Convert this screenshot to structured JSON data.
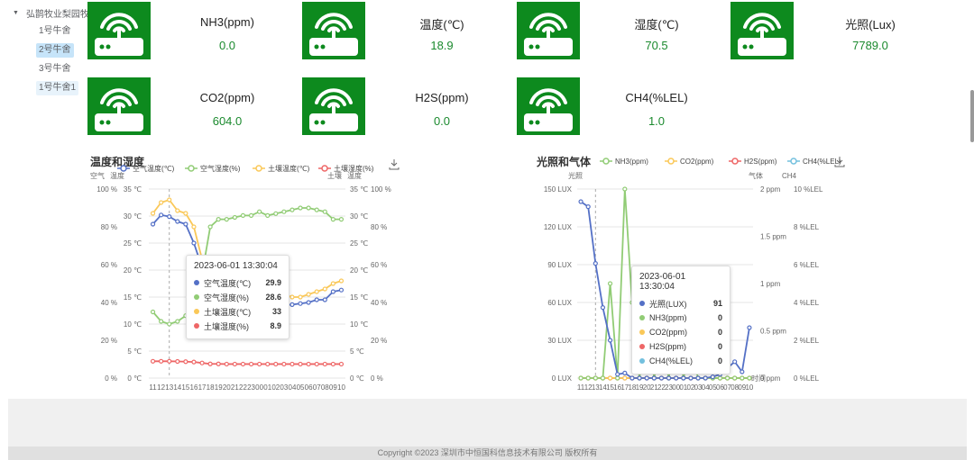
{
  "tree": {
    "root": "弘鹊牧业梨园牧场",
    "items": [
      {
        "label": "1号牛舍",
        "state": ""
      },
      {
        "label": "2号牛舍",
        "state": "active"
      },
      {
        "label": "3号牛舍",
        "state": ""
      },
      {
        "label": "1号牛舍1",
        "state": "current"
      }
    ]
  },
  "sensors": [
    {
      "name": "NH3(ppm)",
      "value": "0.0"
    },
    {
      "name": "温度(℃)",
      "value": "18.9"
    },
    {
      "name": "湿度(℃)",
      "value": "70.5"
    },
    {
      "name": "光照(Lux)",
      "value": "7789.0"
    },
    {
      "name": "CO2(ppm)",
      "value": "604.0"
    },
    {
      "name": "H2S(ppm)",
      "value": "0.0"
    },
    {
      "name": "CH4(%LEL)",
      "value": "1.0"
    }
  ],
  "colors": {
    "brand_green": "#0d8a1e",
    "value_green": "#1b8a2e",
    "blue": "#5470c6",
    "green": "#91cc75",
    "yellow": "#fac858",
    "red": "#ee6666",
    "cyan": "#73c0de"
  },
  "chart_data": [
    {
      "type": "line",
      "title": "温度和湿度",
      "legend": [
        "空气温度(℃)",
        "空气湿度(%)",
        "土壤温度(℃)",
        "土壤湿度(%)"
      ],
      "axis_names": [
        "空气",
        "温度",
        "土壤",
        "温度"
      ],
      "x": [
        "11",
        "12",
        "13",
        "14",
        "15",
        "16",
        "17",
        "18",
        "19",
        "20",
        "21",
        "22",
        "23",
        "00",
        "01",
        "02",
        "03",
        "04",
        "05",
        "06",
        "07",
        "08",
        "09",
        "10"
      ],
      "y_left_pct_ticks": [
        "0 %",
        "20 %",
        "40 %",
        "60 %",
        "80 %",
        "100 %"
      ],
      "y_left_c_ticks": [
        "0 ℃",
        "5 ℃",
        "10 ℃",
        "15 ℃",
        "20 ℃",
        "25 ℃",
        "30 ℃",
        "35 ℃"
      ],
      "y_right_c_ticks": [
        "0 ℃",
        "5 ℃",
        "10 ℃",
        "15 ℃",
        "20 ℃",
        "25 ℃",
        "30 ℃",
        "35 ℃"
      ],
      "y_right_pct_ticks": [
        "0 %",
        "20 %",
        "40 %",
        "60 %",
        "80 %",
        "100 %"
      ],
      "series": [
        {
          "name": "空气温度(℃)",
          "axis": "c",
          "color": "#5470c6",
          "values": [
            28.5,
            30.2,
            29.9,
            29.0,
            28.5,
            25.0,
            20.5,
            18.5,
            17.5,
            16.5,
            16.0,
            15.5,
            15.0,
            14.5,
            14.0,
            13.8,
            13.5,
            13.6,
            13.8,
            14.0,
            14.5,
            14.5,
            16.0,
            16.3
          ]
        },
        {
          "name": "空气湿度(%)",
          "axis": "p",
          "color": "#91cc75",
          "values": [
            35.0,
            30.0,
            28.6,
            30.0,
            33.0,
            40.0,
            55.0,
            80.0,
            84.0,
            84.0,
            85.0,
            86.0,
            86.0,
            88.0,
            86.0,
            87.0,
            88.0,
            89.0,
            90.0,
            90.0,
            89.0,
            88.0,
            84.0,
            84.0
          ]
        },
        {
          "name": "土壤温度(℃)",
          "axis": "c",
          "color": "#fac858",
          "values": [
            30.5,
            32.5,
            33.0,
            31.0,
            30.5,
            28.0,
            22.0,
            20.5,
            19.5,
            18.5,
            18.0,
            17.0,
            16.5,
            16.0,
            15.5,
            15.5,
            15.5,
            15.0,
            15.0,
            15.5,
            16.0,
            16.5,
            17.5,
            18.0
          ]
        },
        {
          "name": "土壤湿度(%)",
          "axis": "p",
          "color": "#ee6666",
          "values": [
            8.9,
            8.9,
            8.9,
            8.8,
            8.7,
            8.5,
            8.0,
            7.5,
            7.5,
            7.4,
            7.4,
            7.4,
            7.4,
            7.4,
            7.4,
            7.4,
            7.4,
            7.4,
            7.4,
            7.4,
            7.4,
            7.4,
            7.4,
            7.4
          ]
        }
      ],
      "tooltip": {
        "time": "2023-06-01 13:30:04",
        "rows": [
          {
            "name": "空气温度(℃)",
            "value": "29.9",
            "color": "#5470c6"
          },
          {
            "name": "空气湿度(%)",
            "value": "28.6",
            "color": "#91cc75"
          },
          {
            "name": "土壤温度(℃)",
            "value": "33",
            "color": "#fac858"
          },
          {
            "name": "土壤湿度(%)",
            "value": "8.9",
            "color": "#ee6666"
          }
        ]
      }
    },
    {
      "type": "line",
      "title": "光照和气体",
      "legend": [
        "NH3(ppm)",
        "CO2(ppm)",
        "H2S(ppm)",
        "CH4(%LEL)"
      ],
      "axis_names": [
        "光照",
        "气体",
        "CH4",
        "时间"
      ],
      "x": [
        "11",
        "12",
        "13",
        "14",
        "15",
        "16",
        "17",
        "18",
        "19",
        "20",
        "21",
        "22",
        "23",
        "00",
        "01",
        "02",
        "03",
        "04",
        "05",
        "06",
        "07",
        "08",
        "09",
        "10"
      ],
      "y_lux_ticks": [
        "0 LUX",
        "30 LUX",
        "60 LUX",
        "90 LUX",
        "120 LUX",
        "150 LUX"
      ],
      "y_ppm_ticks": [
        "0 ppm",
        "0.5 ppm",
        "1 ppm",
        "1.5 ppm",
        "2 ppm"
      ],
      "y_lel_ticks": [
        "0 %LEL",
        "2 %LEL",
        "4 %LEL",
        "6 %LEL",
        "8 %LEL",
        "10 %LEL"
      ],
      "series": [
        {
          "name": "光照(LUX)",
          "axis": "lux",
          "color": "#5470c6",
          "values": [
            140,
            136,
            91,
            56,
            30,
            3,
            4,
            0,
            0,
            0,
            0,
            0,
            0,
            0,
            0,
            0,
            0,
            0,
            1,
            3,
            8,
            13,
            5,
            40
          ]
        },
        {
          "name": "NH3(ppm)",
          "axis": "ppm",
          "color": "#91cc75",
          "values": [
            0,
            0,
            0,
            0,
            1.0,
            0,
            2.0,
            0.8,
            0,
            0.6,
            0,
            0.4,
            0,
            0.5,
            0,
            0.3,
            0,
            0,
            0,
            0,
            0,
            0,
            0,
            0
          ]
        },
        {
          "name": "CO2(ppm)",
          "axis": "ppm",
          "color": "#fac858",
          "values": [
            0,
            0,
            0,
            0,
            0,
            0,
            0,
            0,
            0,
            0,
            0,
            0,
            0,
            0,
            0,
            0,
            0,
            0,
            0,
            0,
            0,
            0,
            0,
            0
          ]
        },
        {
          "name": "H2S(ppm)",
          "axis": "ppm",
          "color": "#ee6666",
          "values": [
            0,
            0,
            0,
            0,
            0,
            0,
            0,
            0,
            0,
            0,
            0,
            0,
            0,
            0,
            0,
            0,
            0,
            0,
            0,
            0,
            0,
            0,
            0,
            0
          ]
        },
        {
          "name": "CH4(%LEL)",
          "axis": "lel",
          "color": "#73c0de",
          "values": [
            0,
            0,
            0,
            0,
            0,
            0,
            0,
            0,
            0,
            0,
            0,
            0,
            0,
            0,
            0,
            0,
            0,
            0,
            0,
            0,
            0,
            0,
            0,
            0
          ]
        }
      ],
      "tooltip": {
        "time": "2023-06-01 13:30:04",
        "rows": [
          {
            "name": "光照(LUX)",
            "value": "91",
            "color": "#5470c6"
          },
          {
            "name": "NH3(ppm)",
            "value": "0",
            "color": "#91cc75"
          },
          {
            "name": "CO2(ppm)",
            "value": "0",
            "color": "#fac858"
          },
          {
            "name": "H2S(ppm)",
            "value": "0",
            "color": "#ee6666"
          },
          {
            "name": "CH4(%LEL)",
            "value": "0",
            "color": "#73c0de"
          }
        ]
      }
    }
  ],
  "footer": "Copyright ©2023 深圳市中恒国科信息技术有限公司 版权所有"
}
